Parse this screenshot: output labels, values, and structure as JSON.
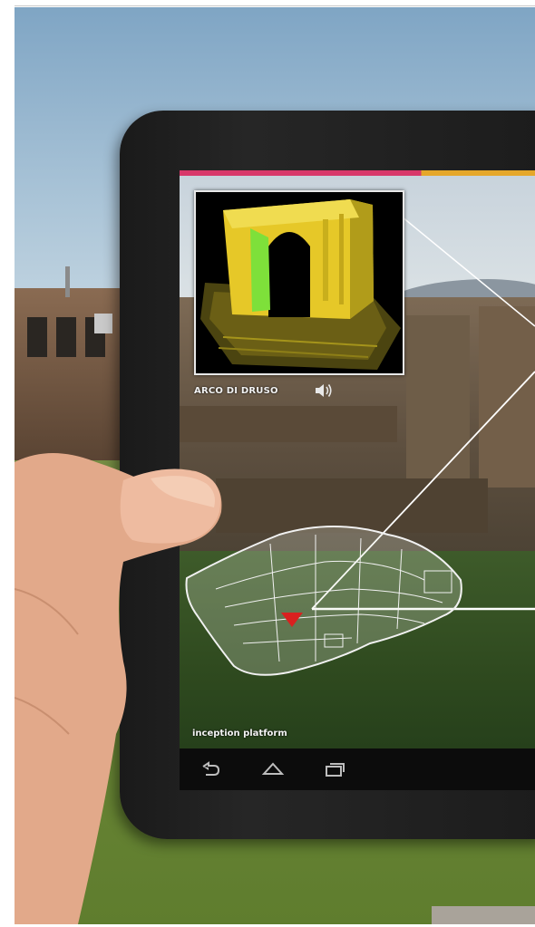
{
  "overlay": {
    "monument_label": "ARCO DI DRUSO",
    "platform_label": "inception platform"
  },
  "icons": {
    "audio": "speaker-icon",
    "nav_back": "back-arrow-icon",
    "nav_home": "home-icon",
    "nav_recent": "recent-apps-icon"
  },
  "colors": {
    "accent_bar_left": "#d8386a",
    "accent_bar_right": "#e5a72a",
    "model_yellow": "#e6c828",
    "model_green": "#7ee03a",
    "marker_red": "#d9201f"
  }
}
